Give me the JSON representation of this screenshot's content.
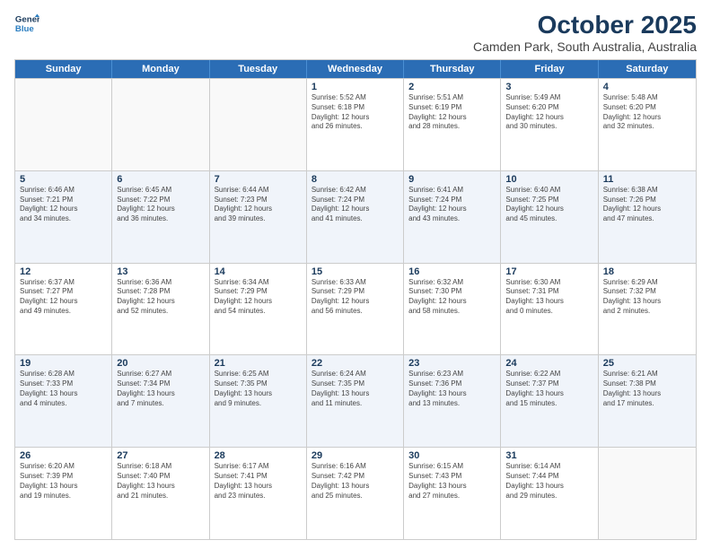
{
  "logo": {
    "line1": "General",
    "line2": "Blue"
  },
  "title": "October 2025",
  "location": "Camden Park, South Australia, Australia",
  "header_days": [
    "Sunday",
    "Monday",
    "Tuesday",
    "Wednesday",
    "Thursday",
    "Friday",
    "Saturday"
  ],
  "weeks": [
    [
      {
        "day": "",
        "text": ""
      },
      {
        "day": "",
        "text": ""
      },
      {
        "day": "",
        "text": ""
      },
      {
        "day": "1",
        "text": "Sunrise: 5:52 AM\nSunset: 6:18 PM\nDaylight: 12 hours\nand 26 minutes."
      },
      {
        "day": "2",
        "text": "Sunrise: 5:51 AM\nSunset: 6:19 PM\nDaylight: 12 hours\nand 28 minutes."
      },
      {
        "day": "3",
        "text": "Sunrise: 5:49 AM\nSunset: 6:20 PM\nDaylight: 12 hours\nand 30 minutes."
      },
      {
        "day": "4",
        "text": "Sunrise: 5:48 AM\nSunset: 6:20 PM\nDaylight: 12 hours\nand 32 minutes."
      }
    ],
    [
      {
        "day": "5",
        "text": "Sunrise: 6:46 AM\nSunset: 7:21 PM\nDaylight: 12 hours\nand 34 minutes."
      },
      {
        "day": "6",
        "text": "Sunrise: 6:45 AM\nSunset: 7:22 PM\nDaylight: 12 hours\nand 36 minutes."
      },
      {
        "day": "7",
        "text": "Sunrise: 6:44 AM\nSunset: 7:23 PM\nDaylight: 12 hours\nand 39 minutes."
      },
      {
        "day": "8",
        "text": "Sunrise: 6:42 AM\nSunset: 7:24 PM\nDaylight: 12 hours\nand 41 minutes."
      },
      {
        "day": "9",
        "text": "Sunrise: 6:41 AM\nSunset: 7:24 PM\nDaylight: 12 hours\nand 43 minutes."
      },
      {
        "day": "10",
        "text": "Sunrise: 6:40 AM\nSunset: 7:25 PM\nDaylight: 12 hours\nand 45 minutes."
      },
      {
        "day": "11",
        "text": "Sunrise: 6:38 AM\nSunset: 7:26 PM\nDaylight: 12 hours\nand 47 minutes."
      }
    ],
    [
      {
        "day": "12",
        "text": "Sunrise: 6:37 AM\nSunset: 7:27 PM\nDaylight: 12 hours\nand 49 minutes."
      },
      {
        "day": "13",
        "text": "Sunrise: 6:36 AM\nSunset: 7:28 PM\nDaylight: 12 hours\nand 52 minutes."
      },
      {
        "day": "14",
        "text": "Sunrise: 6:34 AM\nSunset: 7:29 PM\nDaylight: 12 hours\nand 54 minutes."
      },
      {
        "day": "15",
        "text": "Sunrise: 6:33 AM\nSunset: 7:29 PM\nDaylight: 12 hours\nand 56 minutes."
      },
      {
        "day": "16",
        "text": "Sunrise: 6:32 AM\nSunset: 7:30 PM\nDaylight: 12 hours\nand 58 minutes."
      },
      {
        "day": "17",
        "text": "Sunrise: 6:30 AM\nSunset: 7:31 PM\nDaylight: 13 hours\nand 0 minutes."
      },
      {
        "day": "18",
        "text": "Sunrise: 6:29 AM\nSunset: 7:32 PM\nDaylight: 13 hours\nand 2 minutes."
      }
    ],
    [
      {
        "day": "19",
        "text": "Sunrise: 6:28 AM\nSunset: 7:33 PM\nDaylight: 13 hours\nand 4 minutes."
      },
      {
        "day": "20",
        "text": "Sunrise: 6:27 AM\nSunset: 7:34 PM\nDaylight: 13 hours\nand 7 minutes."
      },
      {
        "day": "21",
        "text": "Sunrise: 6:25 AM\nSunset: 7:35 PM\nDaylight: 13 hours\nand 9 minutes."
      },
      {
        "day": "22",
        "text": "Sunrise: 6:24 AM\nSunset: 7:35 PM\nDaylight: 13 hours\nand 11 minutes."
      },
      {
        "day": "23",
        "text": "Sunrise: 6:23 AM\nSunset: 7:36 PM\nDaylight: 13 hours\nand 13 minutes."
      },
      {
        "day": "24",
        "text": "Sunrise: 6:22 AM\nSunset: 7:37 PM\nDaylight: 13 hours\nand 15 minutes."
      },
      {
        "day": "25",
        "text": "Sunrise: 6:21 AM\nSunset: 7:38 PM\nDaylight: 13 hours\nand 17 minutes."
      }
    ],
    [
      {
        "day": "26",
        "text": "Sunrise: 6:20 AM\nSunset: 7:39 PM\nDaylight: 13 hours\nand 19 minutes."
      },
      {
        "day": "27",
        "text": "Sunrise: 6:18 AM\nSunset: 7:40 PM\nDaylight: 13 hours\nand 21 minutes."
      },
      {
        "day": "28",
        "text": "Sunrise: 6:17 AM\nSunset: 7:41 PM\nDaylight: 13 hours\nand 23 minutes."
      },
      {
        "day": "29",
        "text": "Sunrise: 6:16 AM\nSunset: 7:42 PM\nDaylight: 13 hours\nand 25 minutes."
      },
      {
        "day": "30",
        "text": "Sunrise: 6:15 AM\nSunset: 7:43 PM\nDaylight: 13 hours\nand 27 minutes."
      },
      {
        "day": "31",
        "text": "Sunrise: 6:14 AM\nSunset: 7:44 PM\nDaylight: 13 hours\nand 29 minutes."
      },
      {
        "day": "",
        "text": ""
      }
    ]
  ]
}
